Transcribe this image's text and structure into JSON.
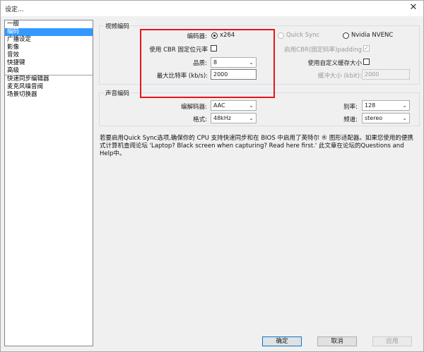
{
  "window": {
    "title": "设定...",
    "close_glyph": "✕"
  },
  "sidebar": {
    "items": [
      {
        "label": "一般",
        "selected": false
      },
      {
        "label": "编码",
        "selected": true
      },
      {
        "label": "广播设定",
        "selected": false
      },
      {
        "label": "影像",
        "selected": false
      },
      {
        "label": "音效",
        "selected": false
      },
      {
        "label": "快捷键",
        "selected": false
      },
      {
        "label": "高级",
        "selected": false
      },
      {
        "label": "快速同步编辑器",
        "selected": false
      },
      {
        "label": "麦克风噪音阀",
        "selected": false
      },
      {
        "label": "场景切换器",
        "selected": false
      }
    ]
  },
  "video": {
    "group_title": "视频编码",
    "encoder_label": "编码器:",
    "encoder_options": {
      "x264": "x264",
      "quick_sync": "Quick Sync",
      "nvidia": "Nvidia NVENC"
    },
    "cbr_label": "使用 CBR 固定位元率",
    "cbr_padding_label": "启用CBR(固定码率)padding",
    "quality_label": "品质:",
    "quality_value": "8",
    "custom_buffer_label": "使用自定义缓存大小",
    "max_bitrate_label": "最大比特率 (kb/s):",
    "max_bitrate_value": "2000",
    "buffer_size_label": "缓冲大小 (kbit):",
    "buffer_size_value": "2000"
  },
  "audio": {
    "group_title": "声音编码",
    "codec_label": "编解码器:",
    "codec_value": "AAC",
    "bitrate_label": "别率:",
    "bitrate_value": "128",
    "format_label": "格式:",
    "format_value": "48kHz",
    "channel_label": "频道:",
    "channel_value": "stereo"
  },
  "help_text": "若要启用Quick Sync选项,确保你的 CPU 支持快速同步和在 BIOS 中启用了英特尔 ® 图形适配器。如果您使用的便携式计算机查阅论坛 'Laptop? Black screen when capturing? Read here first.' 此文章在论坛的Questions and Help中。",
  "buttons": {
    "ok": "确定",
    "cancel": "取消",
    "apply": "应用"
  },
  "accent_color": "#3399ff",
  "highlight_color": "#e8141c"
}
